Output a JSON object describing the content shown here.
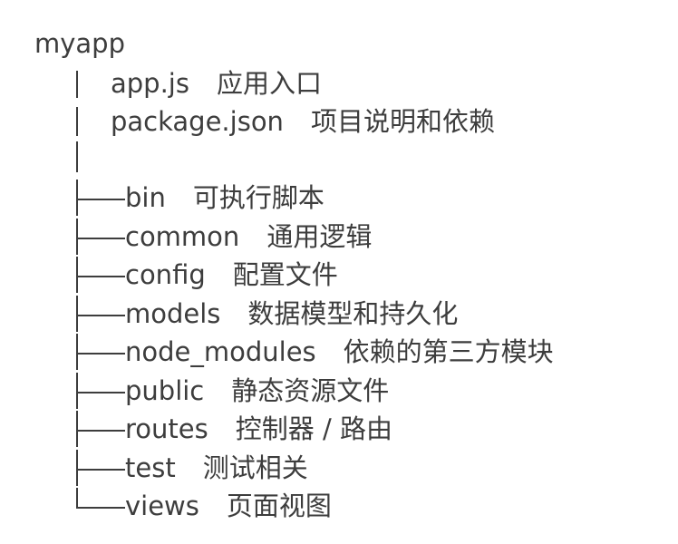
{
  "root": "myapp",
  "files": [
    {
      "name": "app.js",
      "desc": "应用入口"
    },
    {
      "name": "package.json",
      "desc": "项目说明和依赖"
    }
  ],
  "folders": [
    {
      "name": "bin",
      "desc": "可执行脚本"
    },
    {
      "name": "common",
      "desc": "通用逻辑"
    },
    {
      "name": "config",
      "desc": "配置文件"
    },
    {
      "name": "models",
      "desc": "数据模型和持久化"
    },
    {
      "name": "node_modules",
      "desc": "依赖的第三方模块"
    },
    {
      "name": "public",
      "desc": "静态资源文件"
    },
    {
      "name": "routes",
      "desc": "控制器 / 路由"
    },
    {
      "name": "test",
      "desc": "测试相关"
    },
    {
      "name": "views",
      "desc": "页面视图"
    }
  ]
}
